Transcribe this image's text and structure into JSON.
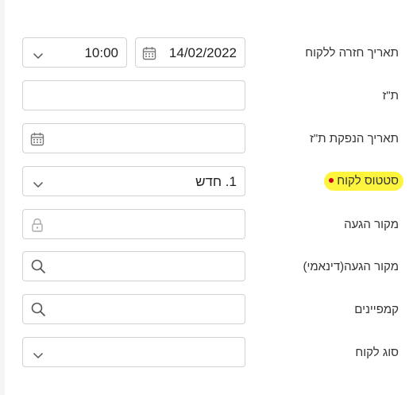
{
  "fields": {
    "return_date": {
      "label": "תאריך חזרה ללקוח",
      "date": "14/02/2022",
      "time": "10:00"
    },
    "id_number": {
      "label": "ת\"ז",
      "value": ""
    },
    "id_issue_date": {
      "label": "תאריך הנפקת ת\"ז",
      "value": ""
    },
    "customer_status": {
      "label": "סטטוס לקוח",
      "value": "1. חדש"
    },
    "arrival_source": {
      "label": "מקור הגעה",
      "value": ""
    },
    "arrival_source_dynamic": {
      "label": "מקור הגעה(דינאמי)",
      "value": ""
    },
    "campaigns": {
      "label": "קמפיינים",
      "value": ""
    },
    "customer_type": {
      "label": "סוג לקוח",
      "value": ""
    }
  },
  "colors": {
    "highlight": "#fdf53d",
    "required_dot": "#d0021b",
    "border": "#cfd3d8"
  }
}
